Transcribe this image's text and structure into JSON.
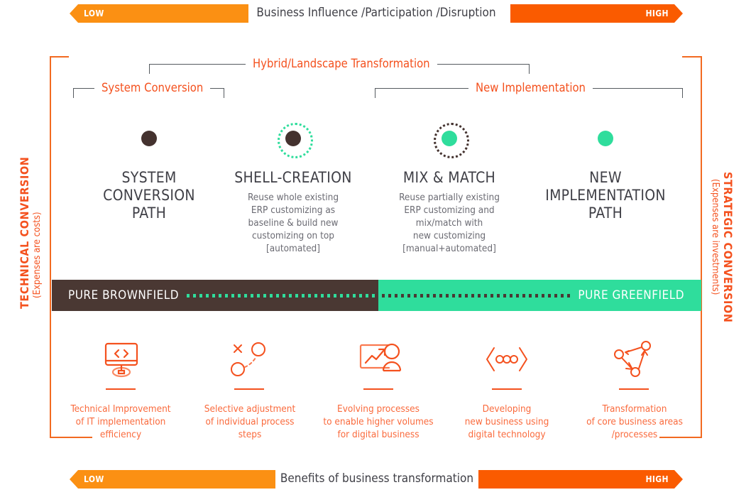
{
  "top_scale": {
    "low_label": "LOW",
    "high_label": "HIGH",
    "center_label": "Business Influence /Participation /Disruption"
  },
  "bottom_scale": {
    "low_label": "LOW",
    "high_label": "HIGH",
    "center_label": "Benefits of business transformation"
  },
  "brackets": {
    "hybrid": "Hybrid/Landscape Transformation",
    "system_conversion": "System Conversion",
    "new_implementation": "New Implementation"
  },
  "columns": [
    {
      "title": "SYSTEM\nCONVERSION\nPATH",
      "title_lines": [
        "SYSTEM",
        "CONVERSION",
        "PATH"
      ],
      "desc_lines": [],
      "dot_color": "#44322F",
      "ring": "none"
    },
    {
      "title": "SHELL-CREATION",
      "title_lines": [
        "SHELL-CREATION"
      ],
      "desc_lines": [
        "Reuse whole existing",
        "ERP customizing as",
        "baseline & build new",
        "customizing on top",
        "[automated]"
      ],
      "dot_color": "#44322F",
      "ring": "green"
    },
    {
      "title": "MIX & MATCH",
      "title_lines": [
        "MIX & MATCH"
      ],
      "desc_lines": [
        "Reuse partially existing",
        "ERP customizing and",
        "mix/match with",
        "new customizing",
        "[manual+automated]"
      ],
      "dot_color": "#2FDD9C",
      "ring": "dark"
    },
    {
      "title": "NEW\nIMPLEMENTATION\nPATH",
      "title_lines": [
        "NEW",
        "IMPLEMENTATION",
        "PATH"
      ],
      "desc_lines": [],
      "dot_color": "#2FDD9C",
      "ring": "none"
    }
  ],
  "field_bar": {
    "left_label": "PURE BROWNFIELD",
    "right_label": "PURE GREENFIELD",
    "left_color": "#4A3833",
    "right_color": "#2FDD9C"
  },
  "benefits": [
    {
      "icon": "monitor-code-icon",
      "lines": [
        "Technical Improvement",
        "of IT implementation",
        "efficiency"
      ]
    },
    {
      "icon": "process-steps-icon",
      "lines": [
        "Selective adjustment",
        "of individual process",
        "steps"
      ]
    },
    {
      "icon": "growth-chart-person-icon",
      "lines": [
        "Evolving processes",
        "to enable higher volumes",
        "for digital business"
      ]
    },
    {
      "icon": "chevrons-dots-icon",
      "lines": [
        "Developing",
        "new business using",
        "digital technology"
      ]
    },
    {
      "icon": "network-nodes-icon",
      "lines": [
        "Transformation",
        "of core business areas",
        "/processes"
      ]
    }
  ],
  "side_labels": {
    "left_main": "TECHNICAL CONVERSION",
    "left_sub": "(Expenses are costs)",
    "right_main": "STRATEGIC CONVERSION",
    "right_sub": "(Expenses are investments)"
  },
  "colors": {
    "orange_accent": "#F4511E",
    "orange_low": "#FB9013",
    "orange_high": "#FA5B00",
    "brown": "#4A3833",
    "green": "#2FDD9C",
    "bracket_gray": "#555a5f"
  }
}
